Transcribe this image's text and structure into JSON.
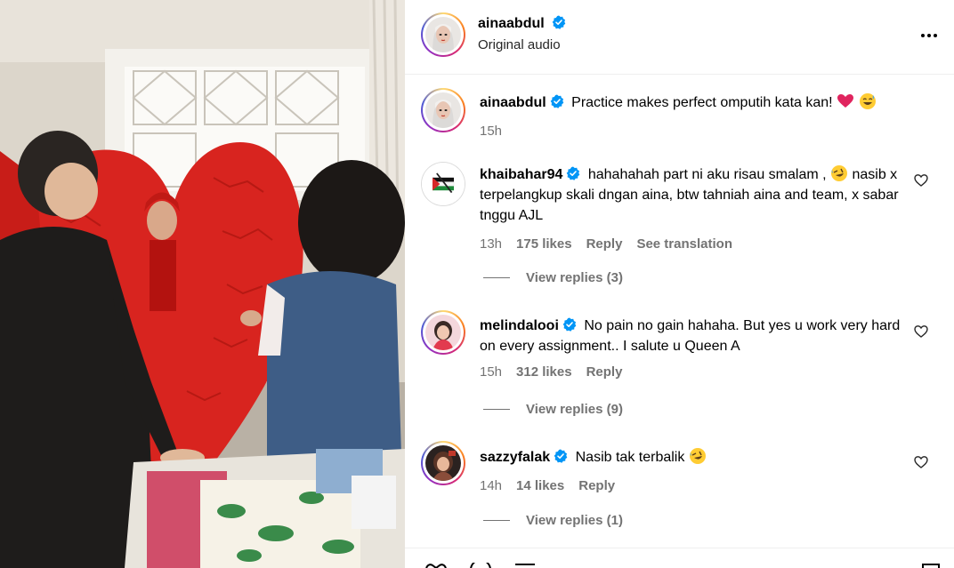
{
  "post": {
    "author": "ainaabdul",
    "audio": "Original audio"
  },
  "caption": {
    "username": "ainaabdul",
    "text": "Practice makes perfect omputih kata kan!",
    "time": "15h"
  },
  "comments": [
    {
      "username": "khaibahar94",
      "text_parts": [
        "hahahahah part ni aku risau smalam ,",
        "nasib x terpelangkup skali dngan aina, btw tahniah aina and team, x sabar tnggu AJL"
      ],
      "time": "13h",
      "likes": "175 likes",
      "reply": "Reply",
      "translate": "See translation",
      "view_replies": "View replies (3)"
    },
    {
      "username": "melindalooi",
      "text": "No pain no gain hahaha. But yes u work very hard on every assignment.. I salute u Queen A",
      "time": "15h",
      "likes": "312 likes",
      "reply": "Reply",
      "view_replies": "View replies (9)"
    },
    {
      "username": "sazzyfalak",
      "text": "Nasib tak terbalik",
      "time": "14h",
      "likes": "14 likes",
      "reply": "Reply",
      "view_replies": "View replies (1)"
    }
  ],
  "colors": {
    "verified": "#0095f6",
    "muted": "#737373",
    "costume_red": "#d8241f"
  },
  "icons": {
    "more": "more-options-icon",
    "like": "heart-outline-icon",
    "verified": "verified-badge-icon"
  }
}
